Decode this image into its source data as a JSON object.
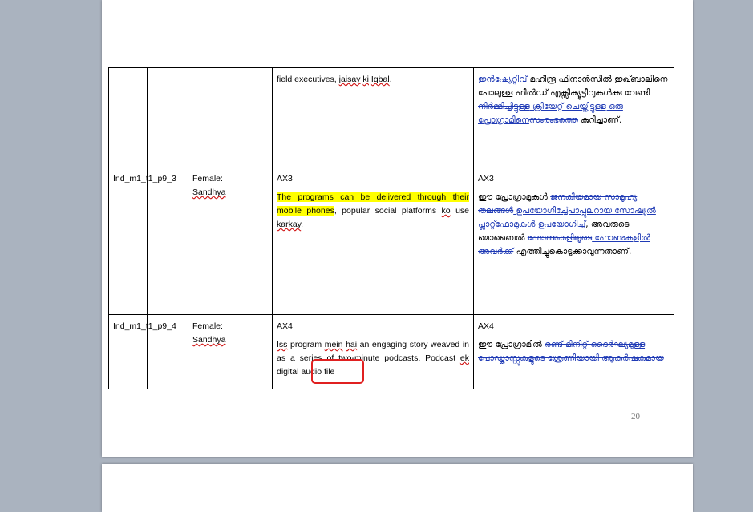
{
  "page_number": "20",
  "rows": [
    {
      "id": "",
      "speaker_label": "",
      "speaker_name": "",
      "code": "",
      "english": [
        "field executives, ",
        "jaisay",
        " ",
        "ki",
        " ",
        "Iqbal",
        "."
      ],
      "malayalam_segments": [
        {
          "t": "ഇന്‍ഷ്യേറ്റിവ്",
          "s": "ins"
        },
        {
          "t": " മഹീന്ദ്ര ഫിനാന്‍സിൽ ഇഖ്ബാലിനെ പോലുള്ള ഫീൽഡ് എക്സിക്യൂട്ടീവുകൾക്കു വേണ്ടി ",
          "s": ""
        },
        {
          "t": "നിർമ്മിച്ചിട്ടുള്ള",
          "s": "del"
        },
        {
          "t": " ക്രിയേറ്റ് ചെയ്തിട്ടുള്ള ഒരു പ്രോഗ്രാമിനെ",
          "s": "ins"
        },
        {
          "t": "സംരംഭത്തെ",
          "s": "del"
        },
        {
          "t": " കുറിച്ചാണ്.",
          "s": ""
        }
      ]
    },
    {
      "id": "Ind_m1_t1_p9_3",
      "speaker_label": "Female:",
      "speaker_name": "Sandhya",
      "code": "AX3",
      "english_highlight": "The programs can be delivered through their mobile phones",
      "english_rest": ", popular social platforms ",
      "english_ko": "ko",
      "english_use": " use ",
      "english_karkay": "karkay",
      "english_end": ".",
      "malayalam_segments": [
        {
          "t": "ഈ പ്രോഗ്രാമുകൾ ",
          "s": ""
        },
        {
          "t": "ജനകീയമായ സാമൂഹ്യ തലങ്ങൾ",
          "s": "del"
        },
        {
          "t": " ഉപയോഗിച്ച്പോപ്പുലറായ സോഷ്യൽ പ്ലാറ്റ്ഫോമുകൾ ഉപയോഗിച്ച്",
          "s": "ins"
        },
        {
          "t": ", അവരുടെ മൊബൈൽ ",
          "s": ""
        },
        {
          "t": "ഫോണുകളിലൂടെ",
          "s": "del"
        },
        {
          "t": " ഫോണുകളിൽ",
          "s": "ins"
        },
        {
          "t": " അവർക്ക്",
          "s": "del"
        },
        {
          "t": " എത്തിച്ചുകൊടുക്കാവുന്നതാണ്.",
          "s": ""
        }
      ]
    },
    {
      "id": "Ind_m1_t1_p9_4",
      "speaker_label": "Female:",
      "speaker_name": "Sandhya",
      "code": "AX4",
      "english_parts": [
        {
          "t": "Iss",
          "s": "sq"
        },
        {
          "t": " program ",
          "s": ""
        },
        {
          "t": "mein",
          "s": "sq"
        },
        {
          "t": " ",
          "s": ""
        },
        {
          "t": "hai",
          "s": "sq"
        },
        {
          "t": " an engaging story weaved in as a series of two-minute podcasts. Podcast ",
          "s": ""
        },
        {
          "t": "ek",
          "s": "sq"
        },
        {
          "t": " digital audio file",
          "s": ""
        }
      ],
      "malayalam_segments": [
        {
          "t": "ഈ പ്രോഗ്രാമിൽ ",
          "s": ""
        },
        {
          "t": "രണ്ട് മിനിറ്റ് ദൈർഘ്യമുള്ള പോഡ്കാസ്റ്റുകളുടെ ശ്രേണിയായി ആകർഷകമായ",
          "s": "del"
        }
      ]
    }
  ]
}
